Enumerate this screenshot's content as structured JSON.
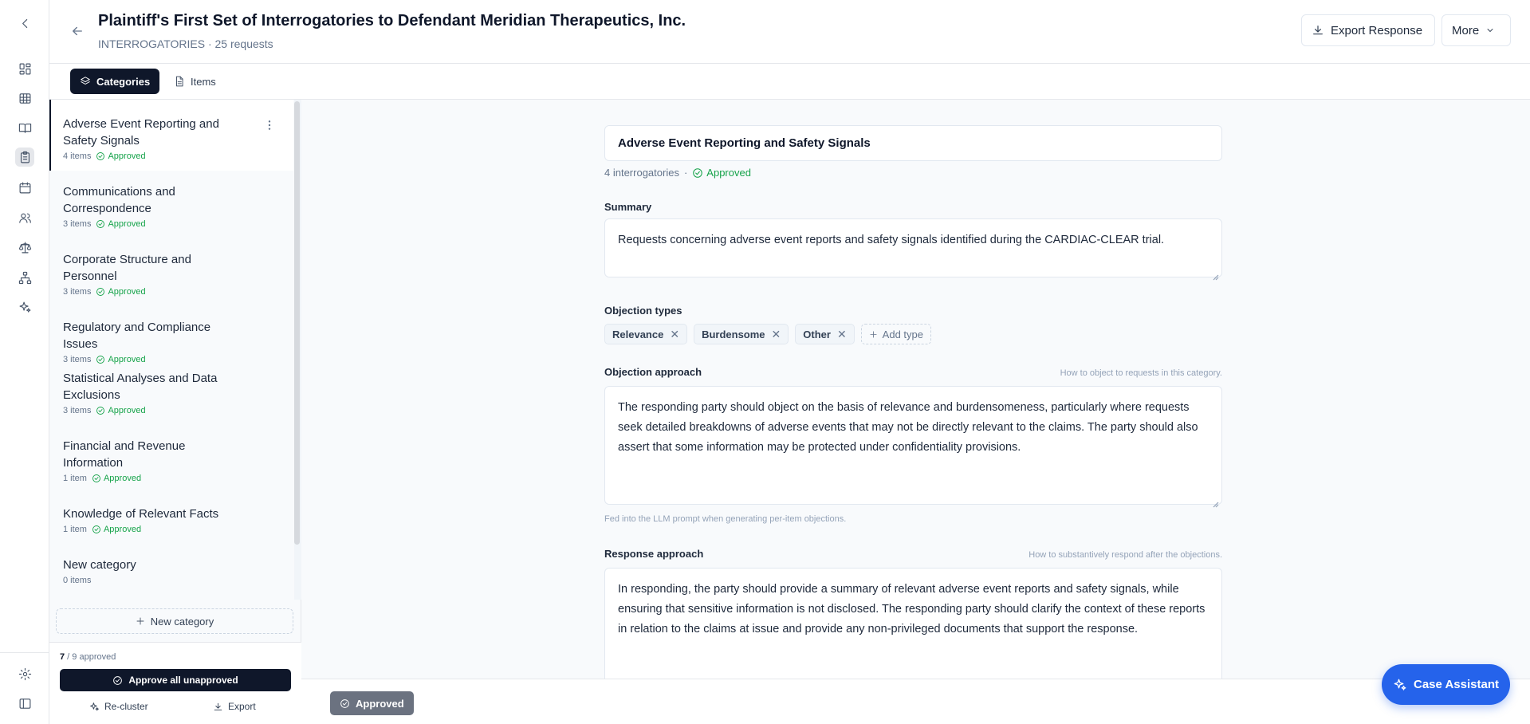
{
  "header": {
    "title": "Plaintiff's First Set of Interrogatories to Defendant Meridian Therapeutics, Inc.",
    "subtitle": "INTERROGATORIES · 25 requests",
    "export_label": "Export Response",
    "more_label": "More"
  },
  "rail": {
    "icons": [
      "collapse-chevron-icon",
      "dashboard-icon",
      "table-icon",
      "book-icon",
      "clipboard-icon",
      "calendar-icon",
      "people-icon",
      "scales-icon",
      "hierarchy-icon",
      "sparkles-icon",
      "settings-icon",
      "sidebar-toggle-icon"
    ]
  },
  "view_toggle": {
    "categories_label": "Categories",
    "items_label": "Items"
  },
  "categories": [
    {
      "name": "Adverse Event Reporting and Safety Signals",
      "count": "4 items",
      "status": "Approved"
    },
    {
      "name": "Communications and Correspondence",
      "count": "3 items",
      "status": "Approved"
    },
    {
      "name": "Corporate Structure and Personnel",
      "count": "3 items",
      "status": "Approved"
    },
    {
      "name": "Regulatory and Compliance Issues",
      "count": "3 items",
      "status": "Approved"
    },
    {
      "name": "Statistical Analyses and Data Exclusions",
      "count": "3 items",
      "status": "Approved"
    },
    {
      "name": "Financial and Revenue Information",
      "count": "1 item",
      "status": "Approved"
    },
    {
      "name": "Knowledge of Relevant Facts",
      "count": "1 item",
      "status": "Approved"
    },
    {
      "name": "New category",
      "count": "0 items",
      "status": ""
    }
  ],
  "sidebar_footer": {
    "new_category_label": "New category",
    "approved_count": "7",
    "approved_total": " / 9 approved",
    "approve_all_label": "Approve all unapproved",
    "recluster_label": "Re-cluster",
    "export_label": "Export"
  },
  "editor": {
    "category_name": "Adverse Event Reporting and Safety Signals",
    "interrogatory_count": "4 interrogatories",
    "status": "Approved",
    "summary_label": "Summary",
    "summary": "Requests concerning adverse event reports and safety signals identified during the CARDIAC-CLEAR trial.",
    "objection_types_label": "Objection types",
    "objection_types": [
      "Relevance",
      "Burdensome",
      "Other"
    ],
    "add_type_label": "Add type",
    "objection_approach_label": "Objection approach",
    "objection_approach_hint": "How to object to requests in this category.",
    "objection_approach": "The responding party should object on the basis of relevance and burdensomeness, particularly where requests seek detailed breakdowns of adverse events that may not be directly relevant to the claims. The party should also assert that some information may be protected under confidentiality provisions.",
    "objection_help": "Fed into the LLM prompt when generating per-item objections.",
    "response_approach_label": "Response approach",
    "response_approach_hint": "How to substantively respond after the objections.",
    "response_approach": "In responding, the party should provide a summary of relevant adverse event reports and safety signals, while ensuring that sensitive information is not disclosed. The responding party should clarify the context of these reports in relation to the claims at issue and provide any non-privileged documents that support the response."
  },
  "action_bar": {
    "approved_label": "Approved"
  },
  "assistant": {
    "label": "Case Assistant"
  },
  "colors": {
    "accent_dark": "#0f172a",
    "approved_green": "#16a34a",
    "assistant_blue": "#2563eb"
  }
}
